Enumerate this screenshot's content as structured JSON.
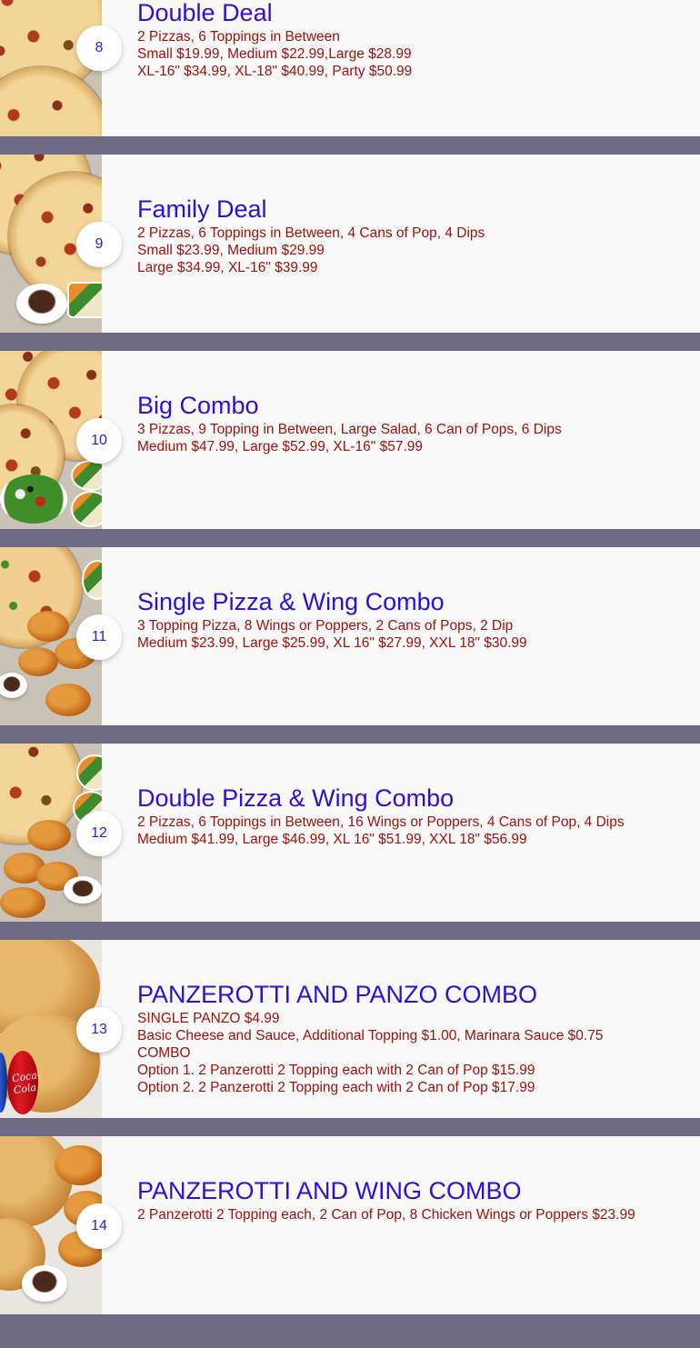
{
  "items": [
    {
      "number": "8",
      "title": "Double Deal",
      "lines": [
        "2 Pizzas, 6 Toppings in Between",
        "Small $19.99, Medium $22.99,Large $28.99",
        "XL-16\" $34.99, XL-18\" $40.99, Party $50.99"
      ]
    },
    {
      "number": "9",
      "title": "Family Deal",
      "lines": [
        "2 Pizzas, 6 Toppings in Between, 4 Cans of Pop, 4 Dips",
        "Small $23.99, Medium $29.99",
        "Large $34.99, XL-16\" $39.99"
      ]
    },
    {
      "number": "10",
      "title": "Big Combo",
      "lines": [
        "3 Pizzas, 9 Topping in Between, Large Salad, 6 Can of Pops, 6 Dips",
        "Medium $47.99, Large $52.99, XL-16\" $57.99"
      ]
    },
    {
      "number": "11",
      "title": "Single Pizza & Wing Combo",
      "lines": [
        "3 Topping Pizza, 8 Wings or Poppers, 2 Cans of Pops, 2 Dip",
        "Medium $23.99, Large $25.99, XL 16\" $27.99, XXL 18\" $30.99"
      ]
    },
    {
      "number": "12",
      "title": "Double Pizza & Wing Combo",
      "lines": [
        "2 Pizzas, 6 Toppings in Between, 16 Wings or Poppers, 4 Cans of Pop, 4 Dips",
        "Medium $41.99, Large $46.99, XL 16\" $51.99, XXL 18\" $56.99"
      ]
    },
    {
      "number": "13",
      "title": "PANZEROTTI AND PANZO COMBO",
      "lines": [
        "SINGLE PANZO $4.99",
        "Basic Cheese and Sauce, Additional Topping $1.00, Marinara Sauce $0.75",
        "COMBO",
        "Option 1. 2 Panzerotti 2 Topping each with 2 Can of Pop $15.99",
        "Option 2. 2 Panzerotti 2 Topping each with 2 Can of Pop $17.99"
      ]
    },
    {
      "number": "14",
      "title": "PANZEROTTI AND WING COMBO",
      "lines": [
        "2 Panzerotti 2 Topping each, 2 Can of Pop, 8 Chicken Wings or Poppers $23.99"
      ]
    }
  ],
  "can_logo": "Coca-Cola",
  "colors": {
    "separator": "#6e6a86",
    "card_bg": "#f9f9f9",
    "title": "#2a10d8",
    "details": "#a0110c"
  }
}
